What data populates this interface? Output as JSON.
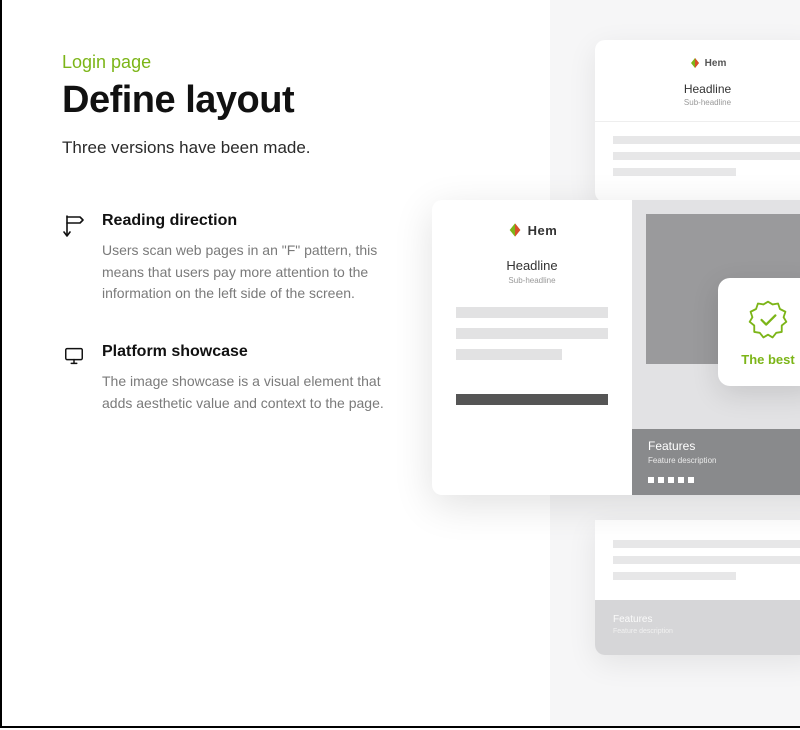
{
  "eyebrow": "Login page",
  "title": "Define layout",
  "subtitle": "Three versions have been made.",
  "features": [
    {
      "heading": "Reading direction",
      "body": "Users scan web pages in an \"F\" pattern, this means that users pay more attention to the information on the left side of the screen."
    },
    {
      "heading": "Platform showcase",
      "body": "The image showcase is a visual element that adds aesthetic value and context to the page."
    }
  ],
  "wireframe": {
    "brand": "Hem",
    "headline": "Headline",
    "subheadline": "Sub-headline",
    "features_label": "Features",
    "features_desc": "Feature description"
  },
  "badge": {
    "label": "The best"
  },
  "colors": {
    "accent": "#7cb518"
  }
}
